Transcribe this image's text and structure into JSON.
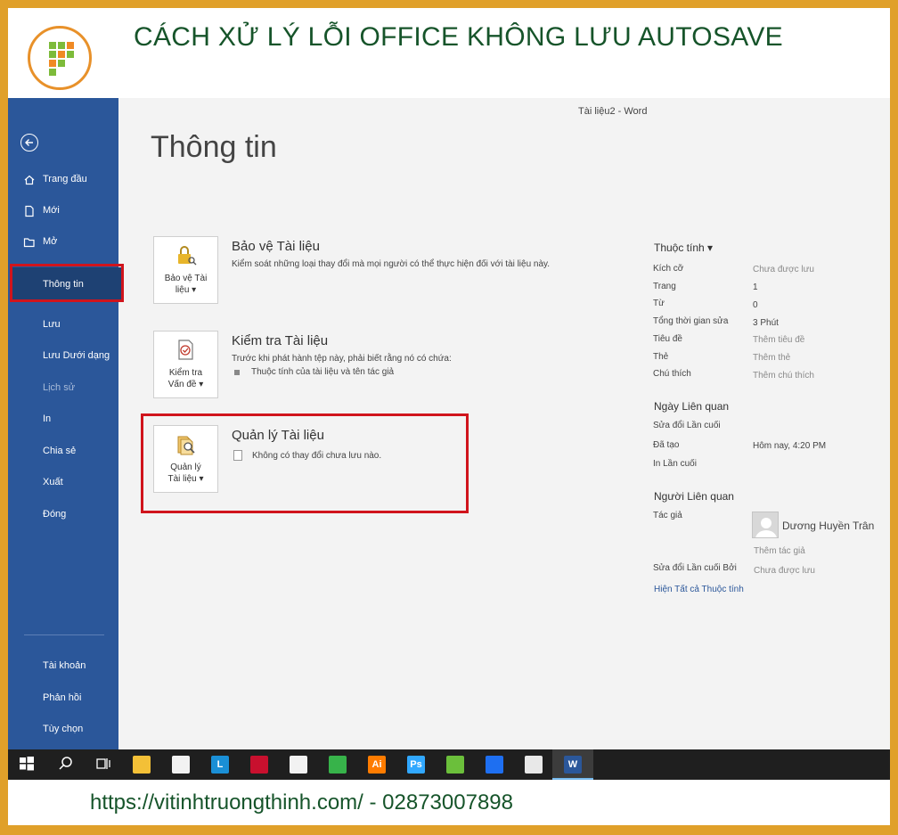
{
  "banner": {
    "title": "CÁCH XỬ LÝ LỖI OFFICE KHÔNG LƯU AUTOSAVE",
    "footer": "https://vitinhtruongthinh.com/ - 02873007898"
  },
  "window": {
    "doc_title": "Tài liệu2  -  Word"
  },
  "sidebar": {
    "items": [
      {
        "label": "Trang đầu",
        "icon": "home-icon"
      },
      {
        "label": "Mới",
        "icon": "new-document-icon"
      },
      {
        "label": "Mở",
        "icon": "folder-open-icon"
      },
      {
        "label": "Thông tin",
        "selected": true
      },
      {
        "label": "Lưu"
      },
      {
        "label": "Lưu Dưới dạng"
      },
      {
        "label": "Lịch sử",
        "disabled": true
      },
      {
        "label": "In"
      },
      {
        "label": "Chia sẻ"
      },
      {
        "label": "Xuất"
      },
      {
        "label": "Đóng"
      }
    ],
    "bottom_items": [
      {
        "label": "Tài khoản"
      },
      {
        "label": "Phản hồi"
      },
      {
        "label": "Tùy chọn"
      }
    ]
  },
  "main": {
    "title": "Thông tin",
    "sections": [
      {
        "button_line1": "Bảo vệ Tài",
        "button_line2": "liệu ▾",
        "title": "Bảo vệ Tài liệu",
        "description": "Kiểm soát những loại thay đổi mà mọi người có thể thực hiện đối với tài liệu này.",
        "icon": "lock-key-icon"
      },
      {
        "button_line1": "Kiểm tra",
        "button_line2": "Vấn đề ▾",
        "title": "Kiểm tra Tài liệu",
        "description": "Trước khi phát hành tệp này, phải biết rằng nó có chứa:",
        "bullet": "Thuộc tính của tài liệu và tên tác giả",
        "icon": "inspect-document-icon"
      },
      {
        "button_line1": "Quản lý",
        "button_line2": "Tài liệu ▾",
        "title": "Quản lý Tài liệu",
        "description": "Không có thay đổi chưa lưu nào.",
        "icon": "manage-document-icon"
      }
    ]
  },
  "properties": {
    "heading": "Thuộc tính ▾",
    "rows": [
      {
        "key": "Kích cỡ",
        "value": "Chưa được lưu",
        "muted": true
      },
      {
        "key": "Trang",
        "value": "1"
      },
      {
        "key": "Từ",
        "value": "0"
      },
      {
        "key": "Tổng thời gian sửa",
        "value": "3 Phút"
      },
      {
        "key": "Tiêu đề",
        "value": "Thêm tiêu đề",
        "muted": true
      },
      {
        "key": "Thẻ",
        "value": "Thêm thẻ",
        "muted": true
      },
      {
        "key": "Chú thích",
        "value": "Thêm chú thích",
        "muted": true
      }
    ],
    "dates_heading": "Ngày Liên quan",
    "dates": [
      {
        "key": "Sửa đổi Lần cuối",
        "value": ""
      },
      {
        "key": "Đã tạo",
        "value": "Hôm nay, 4:20 PM"
      },
      {
        "key": "In Lần cuối",
        "value": ""
      }
    ],
    "people_heading": "Người Liên quan",
    "author_key": "Tác giả",
    "author_name": "Dương Huyền Trân",
    "add_author": "Thêm tác giả",
    "last_modified_by_key": "Sửa đổi Lần cuối Bởi",
    "last_modified_by_value": "Chưa được lưu",
    "show_all_link": "Hiện Tất cả Thuộc tính"
  },
  "taskbar": {
    "apps": [
      {
        "icon": "file-explorer-icon",
        "color": "#f3c037"
      },
      {
        "icon": "store-icon",
        "color": "#f2f2f2"
      },
      {
        "icon": "l-app-icon",
        "color": "#1a8fd6",
        "text": "L"
      },
      {
        "icon": "mcafee-icon",
        "color": "#c8102e"
      },
      {
        "icon": "mail-icon",
        "color": "#f2f2f2"
      },
      {
        "icon": "line-icon",
        "color": "#37b34a"
      },
      {
        "icon": "illustrator-icon",
        "color": "#ff7c00",
        "text": "Ai"
      },
      {
        "icon": "photoshop-icon",
        "color": "#31a8ff",
        "text": "Ps"
      },
      {
        "icon": "coccoc-icon",
        "color": "#6bbf3b"
      },
      {
        "icon": "wps-icon",
        "color": "#1e6ff1"
      },
      {
        "icon": "paint-icon",
        "color": "#e8e8e8"
      },
      {
        "icon": "word-icon",
        "color": "#2b579a"
      }
    ]
  }
}
